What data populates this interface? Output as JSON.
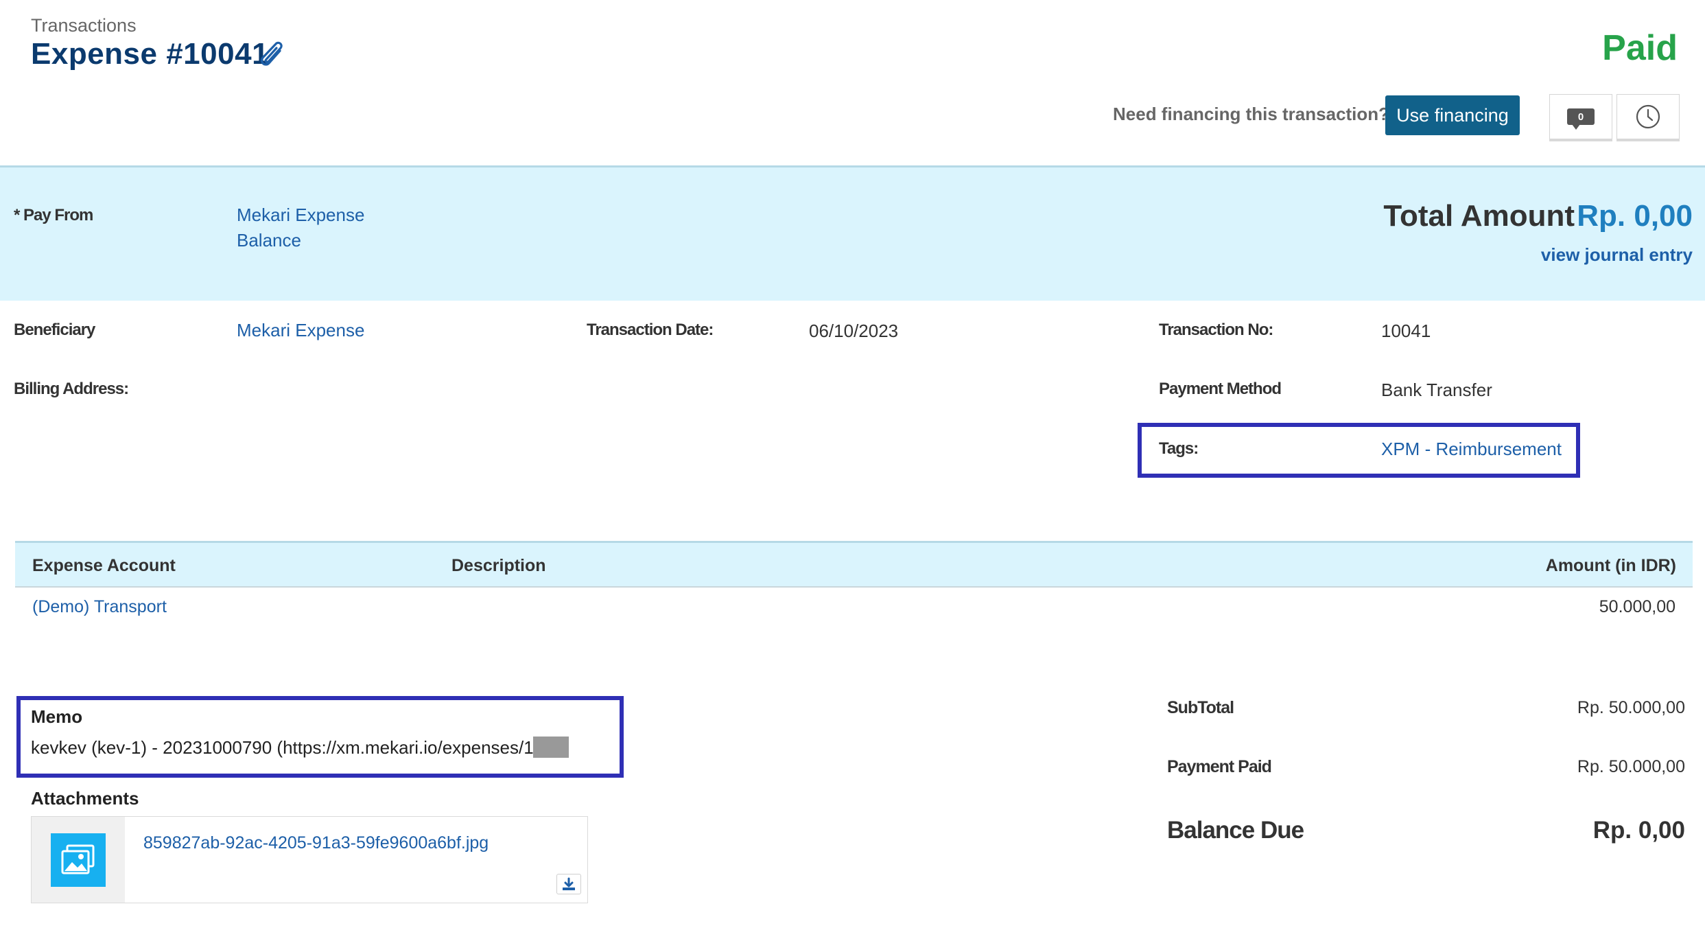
{
  "header": {
    "breadcrumb": "Transactions",
    "title": "Expense #10041",
    "status": "Paid",
    "status_color": "#27a34a",
    "attachment_icon": "paperclip-icon"
  },
  "financing": {
    "question": "Need financing this transaction?",
    "button_label": "Use financing",
    "comment_count": "0",
    "comment_icon": "comment-icon",
    "history_icon": "clock-icon"
  },
  "banner": {
    "pay_from_label": "* Pay From",
    "pay_from_value_line1": "Mekari Expense",
    "pay_from_value_line2": "Balance",
    "total_label": "Total Amount",
    "total_value": "Rp. 0,00",
    "journal_link": "view journal entry"
  },
  "details": {
    "beneficiary_label": "Beneficiary",
    "beneficiary_value": "Mekari Expense",
    "billing_label": "Billing Address:",
    "date_label": "Transaction Date:",
    "date_value": "06/10/2023",
    "trx_no_label": "Transaction No:",
    "trx_no_value": "10041",
    "payment_method_label": "Payment Method",
    "payment_method_value": "Bank Transfer",
    "tags_label": "Tags:",
    "tags_value": "XPM - Reimbursement"
  },
  "table": {
    "headers": [
      "Expense Account",
      "Description",
      "Amount (in IDR)"
    ],
    "rows": [
      {
        "account": "(Demo) Transport",
        "description": "",
        "amount": "50.000,00"
      }
    ]
  },
  "memo": {
    "title": "Memo",
    "text": "kevkev (kev-1) - 20231000790 (https://xm.mekari.io/expenses/15"
  },
  "attachments": {
    "title": "Attachments",
    "files": [
      {
        "name": "859827ab-92ac-4205-91a3-59fe9600a6bf.jpg",
        "thumb_icon": "image-icon",
        "download_icon": "download-icon"
      }
    ]
  },
  "summary": {
    "subtotal_label": "SubTotal",
    "subtotal_value": "Rp. 50.000,00",
    "paid_label": "Payment Paid",
    "paid_value": "Rp. 50.000,00",
    "due_label": "Balance Due",
    "due_value": "Rp. 0,00"
  },
  "colors": {
    "banner_bg": "#daf4fd",
    "link": "#1d5fa8",
    "primary_button": "#11618a",
    "highlight_box": "#2f2fb5"
  }
}
